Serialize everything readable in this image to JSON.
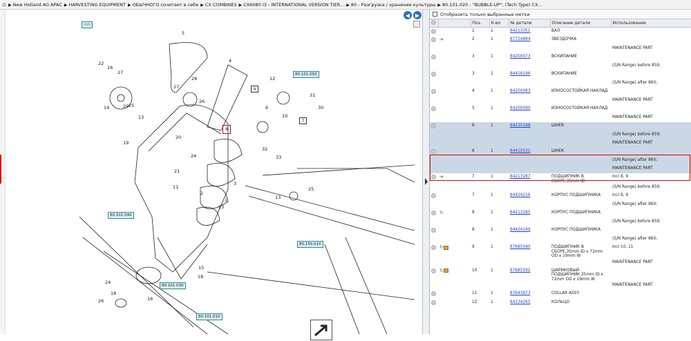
{
  "breadcrumb": [
    "New Holland AG APAC",
    "HARVESTING EQUIPMENT",
    "ОБЫЧНОГО сочитает в себе",
    "CX COMBINES",
    "CX6080 I3 - INTERNATIONAL VERSION TIER...",
    "80 - Разгрузка / хранение культуры",
    "80.101.020 - \"BUBBLE-UP\"; (Tech Type) CX..."
  ],
  "filter_label": "Отобразить только выбранные метки",
  "columns": [
    "",
    "",
    "Поз.",
    "К-во",
    "№ детали",
    "Описание детали",
    "Использование"
  ],
  "diagram": {
    "refs": [
      "80.101.050",
      "80.101.040",
      "80.150.010",
      "80.101.030",
      "80.101.010"
    ],
    "callouts": [
      "5",
      "4",
      "22",
      "16",
      "17",
      "14",
      "29",
      "25",
      "13",
      "28",
      "27",
      "26",
      "8",
      "12",
      "31",
      "30",
      "9",
      "6",
      "10",
      "7",
      "32",
      "33",
      "19",
      "21",
      "20",
      "24",
      "11",
      "2",
      "3",
      "1",
      "23",
      "25",
      "13",
      "15",
      "18",
      "24",
      "26",
      "16",
      "18"
    ]
  },
  "rows": [
    {
      "icon": "circ",
      "pos": "1",
      "qty": "1",
      "part": "84213351",
      "desc": "ВАЛ",
      "usage": "",
      "sel": false
    },
    {
      "icon": "circ-g",
      "pos": "2",
      "qty": "1",
      "part": "87724884",
      "desc": "ЗВЕЗДОЧКА",
      "usage": "",
      "sel": false
    },
    {
      "note": "MAINTENANCE PART",
      "sel": false
    },
    {
      "icon": "circ",
      "pos": "3",
      "qty": "1",
      "part": "84200073",
      "desc": "ВСКИПАНИЕ",
      "usage": "",
      "sel": false
    },
    {
      "note": "(S/N Range) before 859;",
      "sel": false
    },
    {
      "icon": "circ",
      "pos": "3",
      "qty": "1",
      "part": "84418196",
      "desc": "ВСКИПАНИЕ",
      "usage": "",
      "sel": false
    },
    {
      "note": "(S/N Range) after 860;",
      "sel": false
    },
    {
      "icon": "circ",
      "pos": "4",
      "qty": "1",
      "part": "84200083",
      "desc": "ИЗНОСОСТОЙКАЯ НАКЛАД",
      "usage": "",
      "sel": false
    },
    {
      "note": "MAINTENANCE PART",
      "sel": false
    },
    {
      "icon": "circ",
      "pos": "5",
      "qty": "1",
      "part": "84200090",
      "desc": "ИЗНОСОСТОЙКАЯ НАКЛАД",
      "usage": "",
      "sel": false
    },
    {
      "note": "MAINTENANCE PART",
      "sel": false
    },
    {
      "icon": "circ",
      "pos": "6",
      "qty": "1",
      "part": "84230188",
      "desc": "ШНЕК",
      "usage": "",
      "sel": true
    },
    {
      "note": "(S/N Range) before 859;",
      "sel": true
    },
    {
      "note": "MAINTENANCE PART",
      "sel": true
    },
    {
      "icon": "circ",
      "pos": "6",
      "qty": "1",
      "part": "84410531",
      "desc": "ШНЕК",
      "usage": "",
      "sel": true
    },
    {
      "note": "(S/N Range) after 860;",
      "sel": true
    },
    {
      "note": "MAINTENANCE PART",
      "sel": true
    },
    {
      "icon": "circ-g",
      "pos": "7",
      "qty": "1",
      "part": "84213287",
      "desc": "ПОДШИПНИК В СБОРЕ,35mm ID",
      "usage": "Incl 8, 9",
      "sel": false
    },
    {
      "note": "(S/N Range) before 859;",
      "sel": false
    },
    {
      "icon": "circ",
      "pos": "7",
      "qty": "1",
      "part": "84424216",
      "desc": "КОРПУС ПОДШИПНИКА",
      "usage": "Incl 8, 9",
      "sel": false
    },
    {
      "note": "(S/N Range) after 860;",
      "sel": false
    },
    {
      "icon": "circ-b",
      "pos": "8",
      "qty": "1",
      "part": "84213285",
      "desc": "КОРПУС ПОДШИПНИКА",
      "usage": "",
      "sel": false
    },
    {
      "note": "(S/N Range) before 859;",
      "sel": false
    },
    {
      "icon": "circ",
      "pos": "8",
      "qty": "1",
      "part": "84424189",
      "desc": "КОРПУС ПОДШИПНИКА",
      "usage": "",
      "sel": false
    },
    {
      "note": "(S/N Range) after 860;",
      "sel": false
    },
    {
      "icon": "circ-b-box",
      "pos": "9",
      "qty": "1",
      "part": "87685590",
      "desc": "ПОДШИПНИК В СБОРЕ,35mm ID x 72mm OD x 19mm W",
      "usage": "Incl 10, 11",
      "sel": false
    },
    {
      "note": "MAINTENANCE PART",
      "sel": false
    },
    {
      "icon": "circ-box",
      "pos": "10",
      "qty": "1",
      "part": "87685592",
      "desc": "ШАРИКОВЫЙ ПОДШИПНИК,35mm ID x 72mm OD x 19mm W",
      "usage": "",
      "sel": false
    },
    {
      "note": "MAINTENANCE PART",
      "sel": false
    },
    {
      "icon": "circ",
      "pos": "11",
      "qty": "1",
      "part": "87643973",
      "desc": "COLLAR ASSY.",
      "usage": "",
      "sel": false
    },
    {
      "icon": "circ",
      "pos": "12",
      "qty": "1",
      "part": "84334265",
      "desc": "КОЛЬЦО",
      "usage": "",
      "sel": false
    }
  ]
}
